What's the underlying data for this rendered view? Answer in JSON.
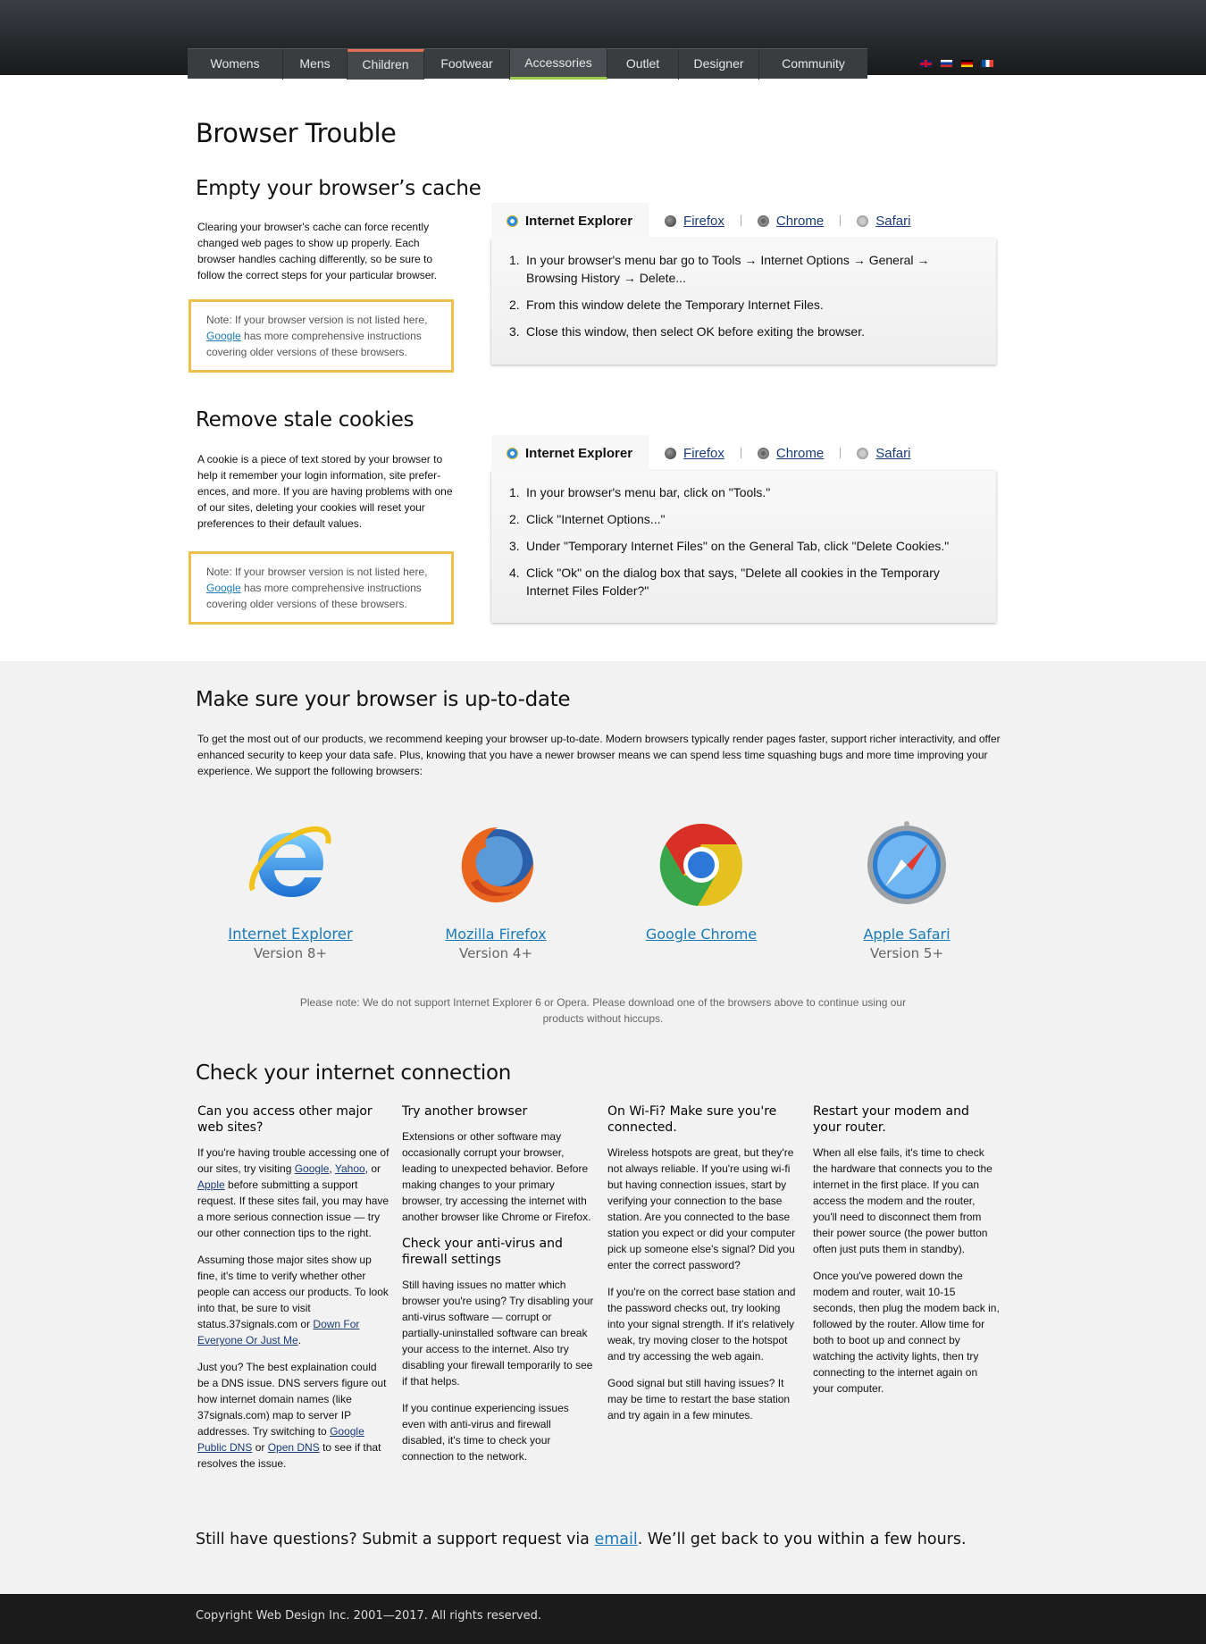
{
  "nav": {
    "items": [
      "Womens",
      "Mens",
      "Children",
      "Footwear",
      "Accessories",
      "Outlet",
      "Designer",
      "Community"
    ],
    "languages": [
      "English",
      "Russian",
      "German",
      "French"
    ]
  },
  "page_title": "Browser Trouble",
  "cache": {
    "heading": "Empty your browser’s cache",
    "intro": "Clearing your browser's cache can force recently changed web pages to show up properly. Each browser handles caching differently, so be sure to follow the correct steps for your particular browser.",
    "note_prefix": "Note: If your browser version is not listed here, ",
    "note_link": "Google",
    "note_suffix": " has more comprehensive instructions covering older versions of these browsers.",
    "tabs": [
      "Internet Explorer",
      "Firefox",
      "Chrome",
      "Safari"
    ],
    "steps": [
      "In your browser's menu bar go to Tools → Internet Options → General → Browsing History → Delete...",
      "From this window delete the Temporary Internet Files.",
      "Close this window, then select OK before exiting the browser."
    ]
  },
  "cookies": {
    "heading": "Remove stale cookies",
    "intro": "A cookie is a piece of text stored by your browser to help it remember your login information, site prefer-ences, and more. If you are having problems with one of our sites, deleting your cookies will reset your preferences to their default values.",
    "note_prefix": "Note: If your browser version is not listed here, ",
    "note_link": "Google",
    "note_suffix": " has more comprehensive instructions covering older versions of these browsers.",
    "tabs": [
      "Internet Explorer",
      "Firefox",
      "Chrome",
      "Safari"
    ],
    "steps": [
      "In your browser's menu bar, click on \"Tools.\"",
      "Click \"Internet Options...\"",
      "Under \"Temporary Internet Files\" on the General Tab, click \"Delete Cookies.\"",
      "Click \"Ok\" on the dialog box that says, \"Delete all cookies in the Temporary Internet Files Folder?\""
    ]
  },
  "update": {
    "heading": "Make sure your browser is up-to-date",
    "intro": "To get the most out of our products, we recommend keeping your browser up-to-date. Modern browsers typically render pages faster, support richer interactivity, and offer enhanced security to keep your data safe. Plus, knowing that you have a newer browser means we can spend less time squashing bugs and more time improving your experience. We support the following browsers:",
    "browsers": [
      {
        "name": "Internet Explorer",
        "version": "Version 8+"
      },
      {
        "name": "Mozilla Firefox",
        "version": "Version 4+"
      },
      {
        "name": "Google Chrome",
        "version": ""
      },
      {
        "name": "Apple Safari",
        "version": "Version 5+"
      }
    ],
    "note": "Please note: We do not support Internet Explorer 6 or Opera. Please download one of the browsers above to continue using our products without hiccups."
  },
  "connection": {
    "heading": "Check your internet connection",
    "col1": {
      "title": "Can you access other major web sites?",
      "p1_a": "If you're having trouble accessing one of our sites, try visiting ",
      "link_google": "Google",
      "sep1": ", ",
      "link_yahoo": "Yahoo",
      "sep2": ", or ",
      "link_apple": "Apple",
      "p1_b": " before submitting a support request. If these sites fail, you may have a more serious connection issue — try our other connection tips to the right.",
      "p2_a": "Assuming those major sites show up fine, it's time to verify whether other people can access our products. To look into that, be sure to visit status.37signals.com or ",
      "link_down": "Down For Everyone Or Just Me",
      "p2_b": ".",
      "p3_a": "Just you? The best explaination could be a DNS issue. DNS servers figure out how internet domain names (like 37signals.com) map to server IP addresses. Try switching to ",
      "link_gdns": "Google Public DNS",
      "p3_or": " or ",
      "link_odns": "Open DNS",
      "p3_b": " to see if that resolves the issue."
    },
    "col2": {
      "title": "Try another browser",
      "p1": "Extensions or other software may occasionally corrupt your browser, leading to unexpected behavior. Before making changes to your primary browser, try accessing the internet with another browser like Chrome or Firefox.",
      "title2": "Check your anti-virus and firewall settings",
      "p2": "Still having issues no matter which browser you're using? Try disabling your anti-virus software — corrupt or partially-uninstalled software can break your access to the internet. Also try disabling your firewall temporarily to see if that helps.",
      "p3": "If you continue experiencing issues even with anti-virus and firewall disabled, it's time to check your connection to the network."
    },
    "col3": {
      "title": "On Wi-Fi? Make sure you're connected.",
      "p1": "Wireless hotspots are great, but they're not always reliable. If you're using wi-fi but having connection issues, start by verifying your connection to the base station. Are you connected to the base station you expect or did your computer pick up someone else's signal? Did you enter the correct password?",
      "p2": "If you're on the correct base station and the password checks out, try looking into your signal strength. If it's relatively weak, try moving closer to the hotspot and try accessing the web again.",
      "p3": "Good signal but still having issues? It may be time to restart the base station and try again in a few minutes."
    },
    "col4": {
      "title": "Restart your modem and your router.",
      "p1": "When all else fails, it's time to check the hardware that connects you to the internet in the first place. If you can access the modem and the router, you'll need to disconnect them from their power source (the power button often just puts them in standby).",
      "p2": "Once you've powered down the modem and router, wait 10-15 seconds, then plug the modem back in, followed by the router. Allow time for both to boot up and connect by watching the activity lights, then try connecting to the internet again on your computer."
    }
  },
  "questions": {
    "prefix": "Still have questions? Submit a support request via ",
    "link": "email",
    "suffix": ". We’ll get back to you within a few hours."
  },
  "footer": {
    "copyright": "Copyright Web Design Inc. 2001—2017. All rights reserved."
  },
  "colors": {
    "accent_link": "#1b7ab7",
    "note_border": "#ecc04a",
    "nav_active_top": "#e07050",
    "nav_active_bottom": "#9cc84a"
  }
}
